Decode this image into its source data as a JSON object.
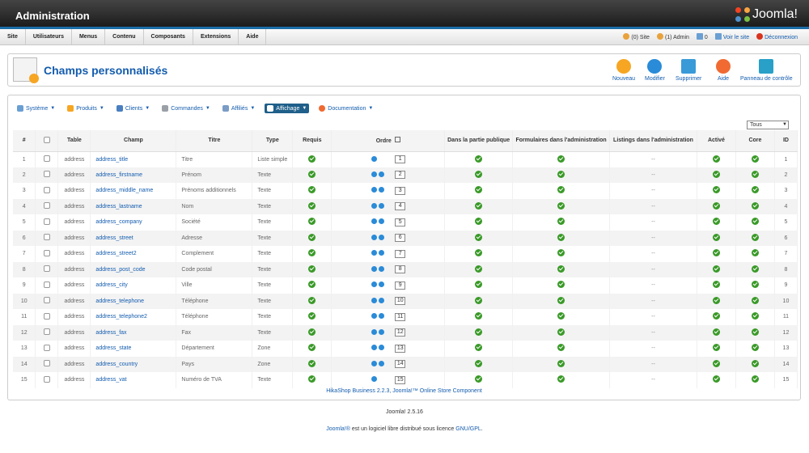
{
  "app": {
    "title": "Administration",
    "logo_text": "Joomla!"
  },
  "menu": [
    "Site",
    "Utilisateurs",
    "Menus",
    "Contenu",
    "Composants",
    "Extensions",
    "Aide"
  ],
  "status": {
    "site_count": "(0) Site",
    "admin_count": "(1) Admin",
    "msg_count": "0",
    "view_site": "Voir le site",
    "logout": "Déconnexion"
  },
  "page_title": "Champs personnalisés",
  "toolbar": {
    "new": "Nouveau",
    "edit": "Modifier",
    "delete": "Supprimer",
    "help": "Aide",
    "cpanel": "Panneau de contrôle"
  },
  "subnav": [
    "Système",
    "Produits",
    "Clients",
    "Commandes",
    "Affiliés",
    "Affichage",
    "Documentation"
  ],
  "filter_value": "Tous",
  "columns": [
    "#",
    "",
    "Table",
    "Champ",
    "Titre",
    "Type",
    "Requis",
    "Ordre",
    "Dans la partie publique",
    "Formulaires dans l'administration",
    "Listings dans l'administration",
    "Activé",
    "Core",
    "ID"
  ],
  "rows": [
    {
      "n": "1",
      "table": "address",
      "field": "address_title",
      "title": "Titre",
      "type": "Liste simple",
      "ord": "1"
    },
    {
      "n": "2",
      "table": "address",
      "field": "address_firstname",
      "title": "Prénom",
      "type": "Texte",
      "ord": "2"
    },
    {
      "n": "3",
      "table": "address",
      "field": "address_middle_name",
      "title": "Prénoms additionnels",
      "type": "Texte",
      "ord": "3"
    },
    {
      "n": "4",
      "table": "address",
      "field": "address_lastname",
      "title": "Nom",
      "type": "Texte",
      "ord": "4"
    },
    {
      "n": "5",
      "table": "address",
      "field": "address_company",
      "title": "Société",
      "type": "Texte",
      "ord": "5"
    },
    {
      "n": "6",
      "table": "address",
      "field": "address_street",
      "title": "Adresse",
      "type": "Texte",
      "ord": "6"
    },
    {
      "n": "7",
      "table": "address",
      "field": "address_street2",
      "title": "Complement",
      "type": "Texte",
      "ord": "7"
    },
    {
      "n": "8",
      "table": "address",
      "field": "address_post_code",
      "title": "Code postal",
      "type": "Texte",
      "ord": "8"
    },
    {
      "n": "9",
      "table": "address",
      "field": "address_city",
      "title": "Ville",
      "type": "Texte",
      "ord": "9"
    },
    {
      "n": "10",
      "table": "address",
      "field": "address_telephone",
      "title": "Téléphone",
      "type": "Texte",
      "ord": "10"
    },
    {
      "n": "11",
      "table": "address",
      "field": "address_telephone2",
      "title": "Téléphone",
      "type": "Texte",
      "ord": "11"
    },
    {
      "n": "12",
      "table": "address",
      "field": "address_fax",
      "title": "Fax",
      "type": "Texte",
      "ord": "12"
    },
    {
      "n": "13",
      "table": "address",
      "field": "address_state",
      "title": "Département",
      "type": "Zone",
      "ord": "13"
    },
    {
      "n": "14",
      "table": "address",
      "field": "address_country",
      "title": "Pays",
      "type": "Zone",
      "ord": "14"
    },
    {
      "n": "15",
      "table": "address",
      "field": "address_vat",
      "title": "Numéro de TVA",
      "type": "Texte",
      "ord": "15"
    }
  ],
  "dash": "--",
  "component_footer": "HikaShop Business 2.2.3, Joomla!™ Online Store Component",
  "version": "Joomla! 2.5.16",
  "license_prefix": "Joomla!®",
  "license_text": " est un logiciel libre distribué sous licence ",
  "license_link": "GNU/GPL",
  "license_suffix": "."
}
